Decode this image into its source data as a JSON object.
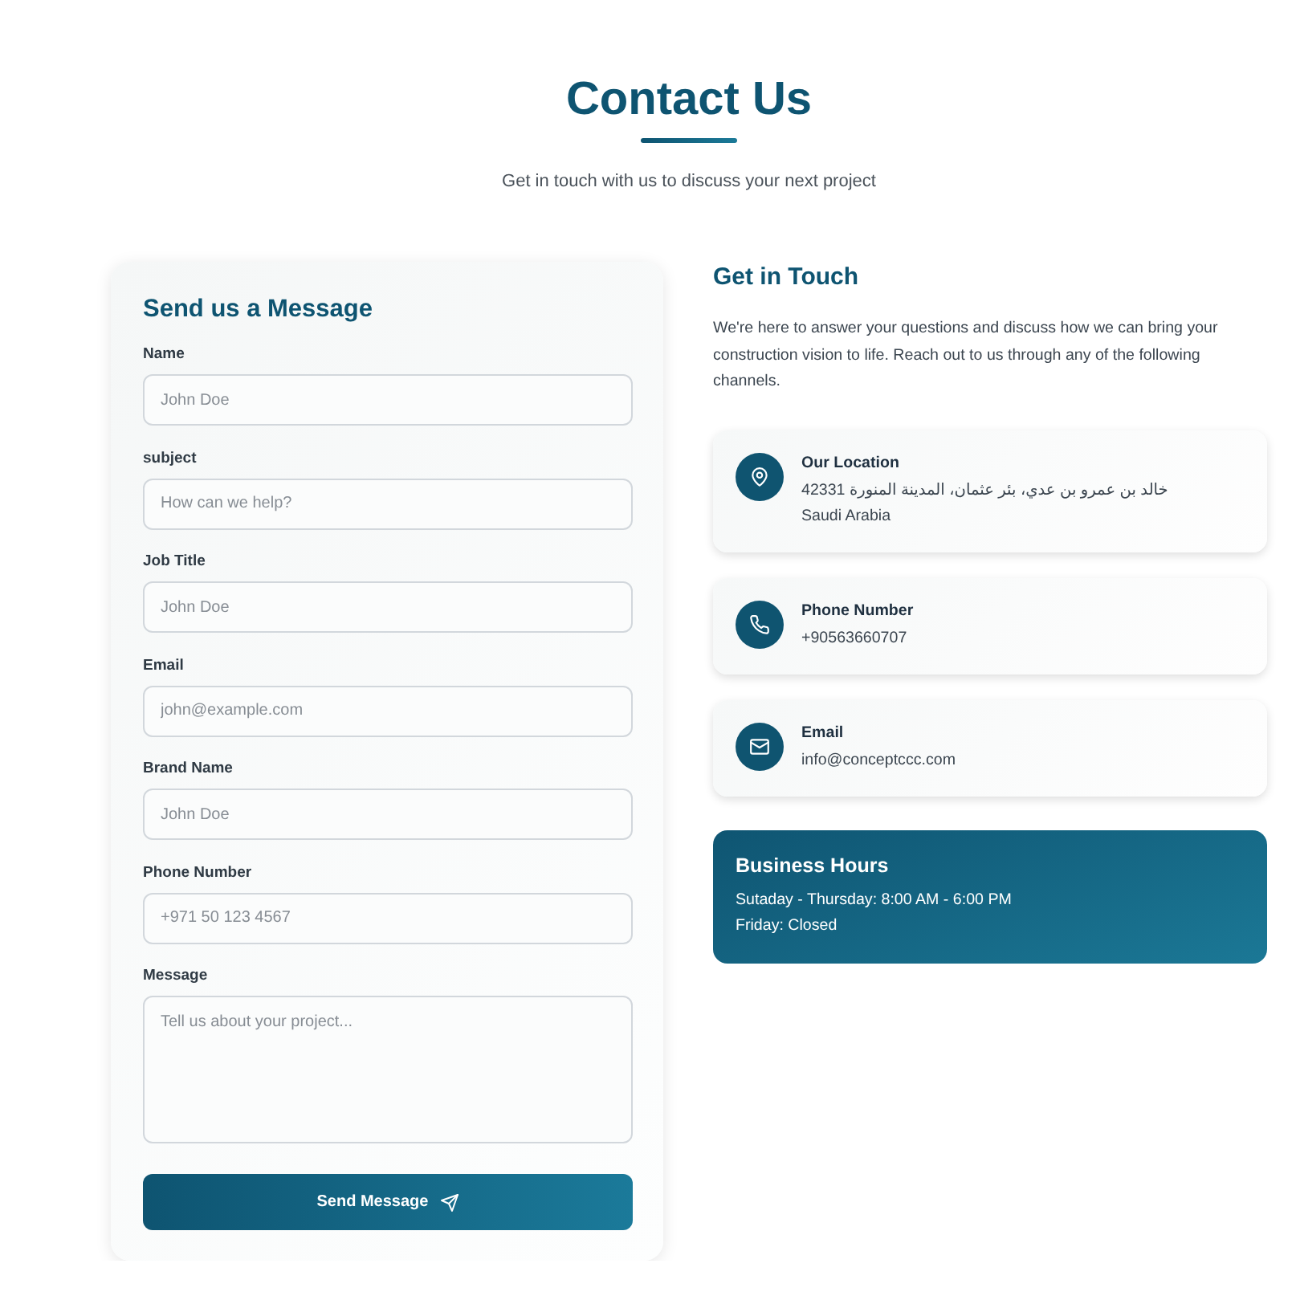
{
  "header": {
    "title": "Contact Us",
    "subtitle": "Get in touch with us to discuss your next project"
  },
  "form": {
    "title": "Send us a Message",
    "fields": [
      {
        "kind": "text",
        "label": "Name",
        "placeholder": "John Doe"
      },
      {
        "kind": "text",
        "label": "subject",
        "placeholder": "How can we help?"
      },
      {
        "kind": "text",
        "label": "Job Title",
        "placeholder": "John Doe"
      },
      {
        "kind": "text",
        "label": "Email",
        "placeholder": "john@example.com"
      },
      {
        "kind": "text",
        "label": "Brand Name",
        "placeholder": "John Doe"
      },
      {
        "kind": "text",
        "label": "Phone Number",
        "placeholder": "+971 50 123 4567"
      },
      {
        "kind": "textarea",
        "label": "Message",
        "placeholder": "Tell us about your project..."
      }
    ],
    "submit": {
      "label": "Send Message"
    }
  },
  "info": {
    "title": "Get in Touch",
    "text": "We're here to answer your questions and discuss how we can bring your construction vision to life. Reach out to us through any of the following channels.",
    "channels": [
      {
        "kind": "location",
        "title": "Our Location",
        "lines": [
          "خالد بن عمرو بن عدي، بئر عثمان، المدينة المنورة 42331",
          "Saudi Arabia"
        ]
      },
      {
        "kind": "phone",
        "title": "Phone Number",
        "lines": [
          "+90563660707"
        ]
      },
      {
        "kind": "email",
        "title": "Email",
        "lines": [
          "info@conceptccc.com"
        ]
      }
    ]
  },
  "hours": {
    "title": "Business Hours",
    "lines": [
      "Sutaday - Thursday: 8:00 AM - 6:00 PM",
      "Friday: Closed"
    ]
  }
}
